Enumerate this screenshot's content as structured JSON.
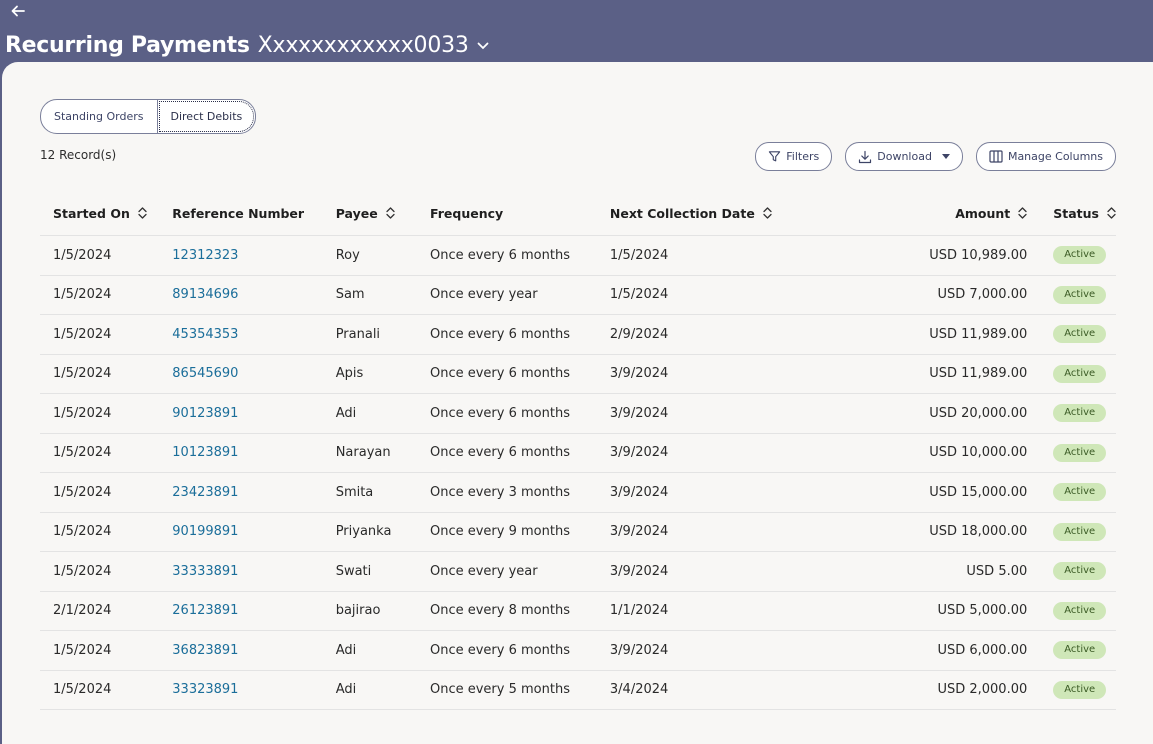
{
  "header": {
    "title": "Recurring Payments",
    "account": "Xxxxxxxxxxxx0033"
  },
  "tabs": [
    {
      "label": "Standing Orders"
    },
    {
      "label": "Direct Debits"
    }
  ],
  "records_label": "12 Record(s)",
  "toolbar": {
    "filters_label": "Filters",
    "download_label": "Download",
    "manage_columns_label": "Manage Columns"
  },
  "columns": {
    "started_on": "Started On",
    "reference": "Reference Number",
    "payee": "Payee",
    "frequency": "Frequency",
    "next_date": "Next Collection Date",
    "amount": "Amount",
    "status": "Status"
  },
  "rows": [
    {
      "started_on": "1/5/2024",
      "reference": "12312323",
      "payee": "Roy",
      "frequency": "Once every 6 months",
      "next_date": "1/5/2024",
      "amount": "USD 10,989.00",
      "status": "Active"
    },
    {
      "started_on": "1/5/2024",
      "reference": "89134696",
      "payee": "Sam",
      "frequency": "Once every year",
      "next_date": "1/5/2024",
      "amount": "USD 7,000.00",
      "status": "Active"
    },
    {
      "started_on": "1/5/2024",
      "reference": "45354353",
      "payee": "Pranali",
      "frequency": "Once every 6 months",
      "next_date": "2/9/2024",
      "amount": "USD 11,989.00",
      "status": "Active"
    },
    {
      "started_on": "1/5/2024",
      "reference": "86545690",
      "payee": "Apis",
      "frequency": "Once every 6 months",
      "next_date": "3/9/2024",
      "amount": "USD 11,989.00",
      "status": "Active"
    },
    {
      "started_on": "1/5/2024",
      "reference": "90123891",
      "payee": "Adi",
      "frequency": "Once every 6 months",
      "next_date": "3/9/2024",
      "amount": "USD 20,000.00",
      "status": "Active"
    },
    {
      "started_on": "1/5/2024",
      "reference": "10123891",
      "payee": "Narayan",
      "frequency": "Once every 6 months",
      "next_date": "3/9/2024",
      "amount": "USD 10,000.00",
      "status": "Active"
    },
    {
      "started_on": "1/5/2024",
      "reference": "23423891",
      "payee": "Smita",
      "frequency": "Once every 3 months",
      "next_date": "3/9/2024",
      "amount": "USD 15,000.00",
      "status": "Active"
    },
    {
      "started_on": "1/5/2024",
      "reference": "90199891",
      "payee": "Priyanka",
      "frequency": "Once every 9 months",
      "next_date": "3/9/2024",
      "amount": "USD 18,000.00",
      "status": "Active"
    },
    {
      "started_on": "1/5/2024",
      "reference": "33333891",
      "payee": "Swati",
      "frequency": "Once every year",
      "next_date": "3/9/2024",
      "amount": "USD 5.00",
      "status": "Active"
    },
    {
      "started_on": "2/1/2024",
      "reference": "26123891",
      "payee": "bajirao",
      "frequency": "Once every 8 months",
      "next_date": "1/1/2024",
      "amount": "USD 5,000.00",
      "status": "Active"
    },
    {
      "started_on": "1/5/2024",
      "reference": "36823891",
      "payee": "Adi",
      "frequency": "Once every 6 months",
      "next_date": "3/9/2024",
      "amount": "USD 6,000.00",
      "status": "Active"
    },
    {
      "started_on": "1/5/2024",
      "reference": "33323891",
      "payee": "Adi",
      "frequency": "Once every 5 months",
      "next_date": "3/4/2024",
      "amount": "USD 2,000.00",
      "status": "Active"
    }
  ]
}
